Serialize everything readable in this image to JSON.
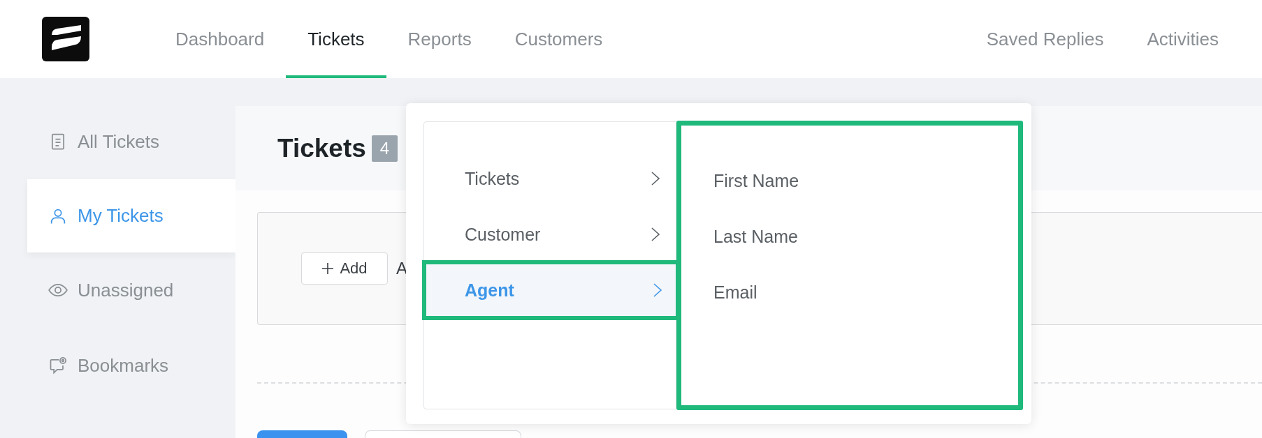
{
  "nav": {
    "left": [
      {
        "label": "Dashboard",
        "selected": false
      },
      {
        "label": "Tickets",
        "selected": true
      },
      {
        "label": "Reports",
        "selected": false
      },
      {
        "label": "Customers",
        "selected": false
      }
    ],
    "right": [
      {
        "label": "Saved Replies"
      },
      {
        "label": "Activities"
      }
    ]
  },
  "sidebar": {
    "items": [
      {
        "label": "All Tickets",
        "selected": false
      },
      {
        "label": "My Tickets",
        "selected": true
      },
      {
        "label": "Unassigned",
        "selected": false
      },
      {
        "label": "Bookmarks",
        "selected": false
      }
    ]
  },
  "main": {
    "title": "Tickets",
    "count": "4",
    "add_button": "Add",
    "cut_text": "A"
  },
  "popover": {
    "categories": [
      {
        "label": "Tickets",
        "selected": false,
        "highlighted": false
      },
      {
        "label": "Customer",
        "selected": false,
        "highlighted": false
      },
      {
        "label": "Agent",
        "selected": true,
        "highlighted": true
      }
    ],
    "fields_highlighted": true,
    "fields": [
      {
        "label": "First Name"
      },
      {
        "label": "Last Name"
      },
      {
        "label": "Email"
      }
    ]
  }
}
